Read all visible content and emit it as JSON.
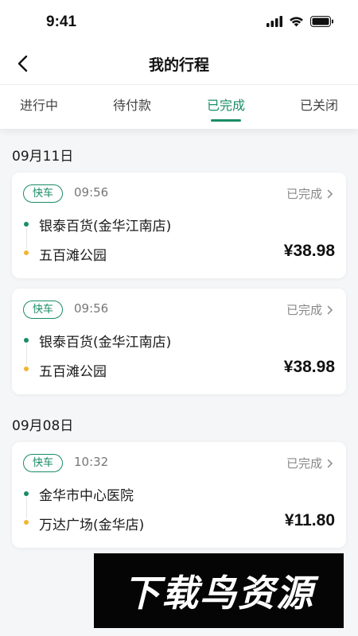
{
  "status_bar": {
    "time": "9:41"
  },
  "nav": {
    "title": "我的行程"
  },
  "tabs": [
    {
      "label": "进行中"
    },
    {
      "label": "待付款"
    },
    {
      "label": "已完成"
    },
    {
      "label": "已关闭"
    }
  ],
  "active_tab": "已完成",
  "colors": {
    "accent": "#1a8d64",
    "destination_dot": "#f2b533"
  },
  "groups": [
    {
      "date": "09月11日",
      "trips": [
        {
          "tag": "快车",
          "time": "09:56",
          "status": "已完成",
          "from": "银泰百货(金华江南店)",
          "to": "五百滩公园",
          "price": "¥38.98"
        },
        {
          "tag": "快车",
          "time": "09:56",
          "status": "已完成",
          "from": "银泰百货(金华江南店)",
          "to": "五百滩公园",
          "price": "¥38.98"
        }
      ]
    },
    {
      "date": "09月08日",
      "trips": [
        {
          "tag": "快车",
          "time": "10:32",
          "status": "已完成",
          "from": "金华市中心医院",
          "to": "万达广场(金华店)",
          "price": "¥11.80"
        }
      ]
    }
  ],
  "watermark": {
    "text": "下载鸟资源"
  }
}
